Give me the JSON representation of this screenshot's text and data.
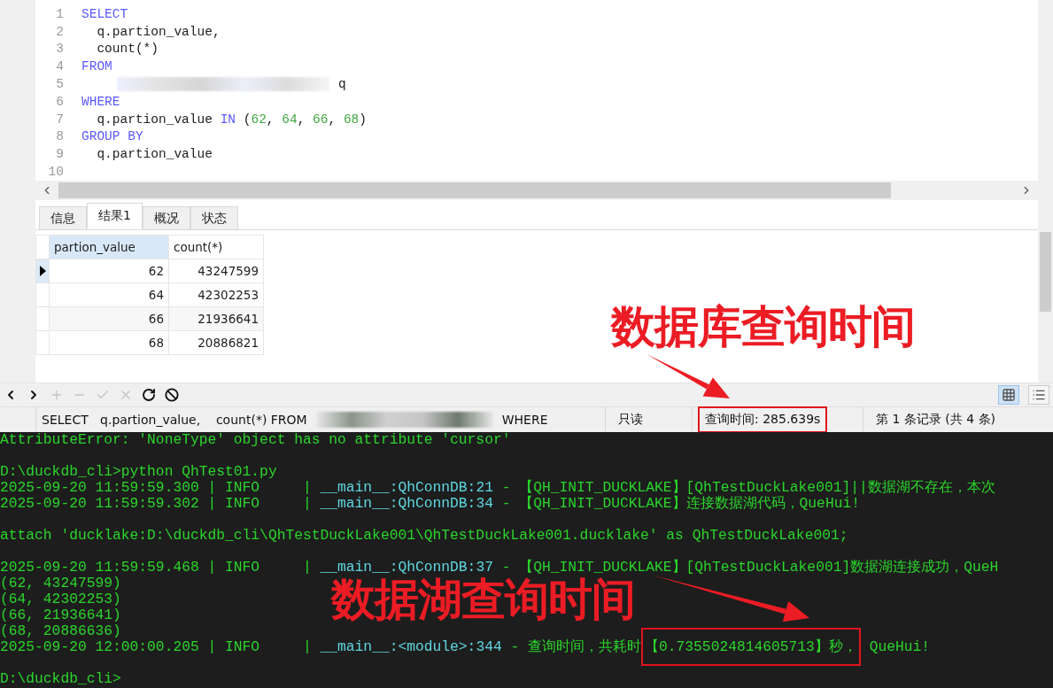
{
  "editor": {
    "lines": [
      {
        "number": "1",
        "tokens": [
          {
            "kind": "keyword",
            "text": "SELECT"
          }
        ]
      },
      {
        "number": "2",
        "tokens": [
          {
            "kind": "plain",
            "text": "  q.partion_value,"
          }
        ]
      },
      {
        "number": "3",
        "tokens": [
          {
            "kind": "plain",
            "text": "  count(*)"
          }
        ]
      },
      {
        "number": "4",
        "tokens": [
          {
            "kind": "keyword",
            "text": "FROM"
          }
        ]
      },
      {
        "number": "5",
        "tokens": [
          {
            "kind": "redacted"
          },
          {
            "kind": "plain",
            "text": "q"
          }
        ]
      },
      {
        "number": "6",
        "tokens": [
          {
            "kind": "keyword",
            "text": "WHERE"
          }
        ]
      },
      {
        "number": "7",
        "tokens": [
          {
            "kind": "plain",
            "text": "  q.partion_value "
          },
          {
            "kind": "keyword",
            "text": "IN"
          },
          {
            "kind": "plain",
            "text": " ("
          },
          {
            "kind": "number",
            "text": "62"
          },
          {
            "kind": "plain",
            "text": ", "
          },
          {
            "kind": "number",
            "text": "64"
          },
          {
            "kind": "plain",
            "text": ", "
          },
          {
            "kind": "number",
            "text": "66"
          },
          {
            "kind": "plain",
            "text": ", "
          },
          {
            "kind": "number",
            "text": "68"
          },
          {
            "kind": "plain",
            "text": ")"
          }
        ]
      },
      {
        "number": "8",
        "tokens": [
          {
            "kind": "keyword",
            "text": "GROUP BY"
          }
        ]
      },
      {
        "number": "9",
        "tokens": [
          {
            "kind": "plain",
            "text": "  q.partion_value"
          }
        ]
      },
      {
        "number": "10"
      }
    ]
  },
  "result_tabs": [
    {
      "label": "信息",
      "selected": false
    },
    {
      "label": "结果1",
      "selected": true
    },
    {
      "label": "概况",
      "selected": false
    },
    {
      "label": "状态",
      "selected": false
    }
  ],
  "table": {
    "columns": [
      {
        "label": "partion_value",
        "selected": true
      },
      {
        "label": "count(*)",
        "selected": false
      }
    ],
    "rows": [
      {
        "selected": true,
        "cells": [
          "62",
          "43247599"
        ]
      },
      {
        "selected": false,
        "cells": [
          "64",
          "42302253"
        ]
      },
      {
        "selected": false,
        "cells": [
          "66",
          "21936641"
        ]
      },
      {
        "selected": false,
        "cells": [
          "68",
          "20886821"
        ]
      }
    ]
  },
  "toolbar": [
    {
      "kind": "prev",
      "disabled": false
    },
    {
      "kind": "next",
      "disabled": false
    },
    {
      "kind": "add",
      "disabled": true
    },
    {
      "kind": "remove",
      "disabled": true
    },
    {
      "kind": "apply",
      "disabled": true
    },
    {
      "kind": "cancel",
      "disabled": true
    },
    {
      "kind": "refresh",
      "disabled": false
    },
    {
      "kind": "stop",
      "disabled": false
    }
  ],
  "view_modes": [
    {
      "kind": "grid",
      "selected": true
    },
    {
      "kind": "form",
      "selected": false
    }
  ],
  "status_bar": [
    {
      "kind": "sql",
      "parts": [
        {
          "kind": "text",
          "text": "SELECT   q.partion_value,    count(*) FROM"
        },
        {
          "kind": "redacted"
        },
        {
          "kind": "text",
          "text": "WHERE"
        }
      ]
    },
    {
      "kind": "text",
      "text": "只读",
      "highlighted": false
    },
    {
      "kind": "text",
      "text": "查询时间: 285.639s",
      "highlighted": true
    },
    {
      "kind": "text",
      "text": "第 1 条记录 (共 4 条)",
      "highlighted": false
    }
  ],
  "terminal": {
    "lines": [
      {
        "kind": "text",
        "segments": [
          {
            "kind": "plain",
            "text": "AttributeError: 'NoneType' object has no attribute 'cursor'"
          }
        ]
      },
      {
        "kind": "blank"
      },
      {
        "kind": "text",
        "segments": [
          {
            "kind": "plain",
            "text": "D:\\duckdb_cli>python QhTest01.py"
          }
        ]
      },
      {
        "kind": "text",
        "segments": [
          {
            "kind": "plain",
            "text": "2025-09-20 11:59:59.300 | INFO     | "
          },
          {
            "kind": "source",
            "text": "__main__:QhConnDB:21"
          },
          {
            "kind": "plain",
            "text": " - 【QH_INIT_DUCKLAKE】[QhTestDuckLake001]||数据湖不存在，本次"
          }
        ]
      },
      {
        "kind": "text",
        "segments": [
          {
            "kind": "plain",
            "text": "2025-09-20 11:59:59.302 | INFO     | "
          },
          {
            "kind": "source",
            "text": "__main__:QhConnDB:34"
          },
          {
            "kind": "plain",
            "text": " - 【QH_INIT_DUCKLAKE】连接数据湖代码，QueHui!"
          }
        ]
      },
      {
        "kind": "blank"
      },
      {
        "kind": "text",
        "segments": [
          {
            "kind": "plain",
            "text": "attach 'ducklake:D:\\duckdb_cli\\QhTestDuckLake001\\QhTestDuckLake001.ducklake' as QhTestDuckLake001;"
          }
        ]
      },
      {
        "kind": "blank"
      },
      {
        "kind": "text",
        "segments": [
          {
            "kind": "plain",
            "text": "2025-09-20 11:59:59.468 | INFO     | "
          },
          {
            "kind": "source",
            "text": "__main__:QhConnDB:37"
          },
          {
            "kind": "plain",
            "text": " - 【QH_INIT_DUCKLAKE】[QhTestDuckLake001]数据湖连接成功，QueH"
          }
        ]
      },
      {
        "kind": "text",
        "segments": [
          {
            "kind": "plain",
            "text": "(62, 43247599)"
          }
        ]
      },
      {
        "kind": "text",
        "segments": [
          {
            "kind": "plain",
            "text": "(64, 42302253)"
          }
        ]
      },
      {
        "kind": "text",
        "segments": [
          {
            "kind": "plain",
            "text": "(66, 21936641)"
          }
        ]
      },
      {
        "kind": "text",
        "segments": [
          {
            "kind": "plain",
            "text": "(68, 20886636)"
          }
        ]
      },
      {
        "kind": "text",
        "segments": [
          {
            "kind": "plain",
            "text": "2025-09-20 12:00:00.205 | INFO     | "
          },
          {
            "kind": "source",
            "text": "__main__:<module>:344"
          },
          {
            "kind": "plain",
            "text": " - 查询时间，共耗时"
          },
          {
            "kind": "highlight",
            "text": "【0.7355024814605713】秒，"
          },
          {
            "kind": "plain",
            "text": " QueHui!"
          }
        ]
      },
      {
        "kind": "blank"
      },
      {
        "kind": "text",
        "segments": [
          {
            "kind": "plain",
            "text": "D:\\duckdb_cli>"
          }
        ]
      }
    ]
  },
  "annotations": [
    {
      "kind": "database",
      "text": "数据库查询时间"
    },
    {
      "kind": "lake",
      "text": "数据湖查询时间"
    }
  ]
}
